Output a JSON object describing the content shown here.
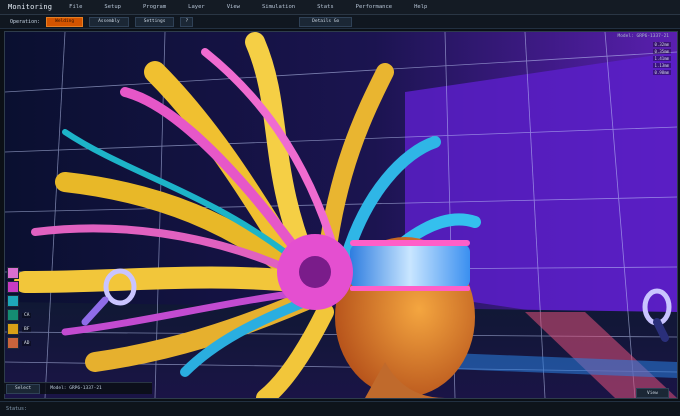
{
  "menubar": {
    "app_title": "Monitoring",
    "items": [
      "File",
      "Setup",
      "Program",
      "Layer",
      "View",
      "Simulation",
      "Stats",
      "Performance",
      "Help"
    ]
  },
  "toolbar": {
    "operation_label": "Operation:",
    "buttons": [
      "Welding",
      "Assembly",
      "Settings",
      "?"
    ],
    "center_button": "Details Go"
  },
  "viewport": {
    "model_label": "Model:   GRP6-1337-21",
    "stats": [
      "0.32mm",
      "0.35mm",
      "1.41mm",
      "1.13mm",
      "0.98mm"
    ]
  },
  "legend": [
    {
      "label": "",
      "color": "#d96fd0"
    },
    {
      "label": "",
      "color": "#c83cc2"
    },
    {
      "label": "",
      "color": "#1ea7b8"
    },
    {
      "label": "CA",
      "color": "#158c72"
    },
    {
      "label": "BF",
      "color": "#d8a017"
    },
    {
      "label": "AD",
      "color": "#c8643c"
    }
  ],
  "bottom": {
    "select_label": "Select",
    "model_text": "Model:   GRP6-1337-21",
    "view_label": "View"
  },
  "status": {
    "text": "Status:"
  }
}
